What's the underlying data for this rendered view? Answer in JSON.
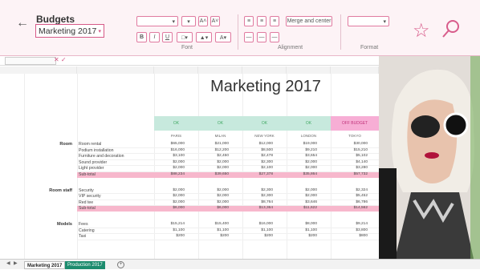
{
  "header": {
    "title": "Budgets",
    "sheet_selected": "Marketing 2017"
  },
  "ribbon": {
    "font_label": "Font",
    "alignment_label": "Alignment",
    "format_label": "Format",
    "merge_label": "Merge and center"
  },
  "sheet": {
    "title": "Marketing 2017",
    "status_row": [
      "OK",
      "OK",
      "OK",
      "OK"
    ],
    "status_alert": "OFF BUDGET",
    "cities": [
      "PARIS",
      "MILAN",
      "NEW YORK",
      "LONDON",
      "TOKYO"
    ],
    "sections": [
      {
        "label": "Room",
        "items": [
          {
            "name": "Room rental",
            "values": [
              "$65,000",
              "$21,000",
              "$12,000",
              "$19,000",
              "$30,000"
            ]
          },
          {
            "name": "Podium installation",
            "values": [
              "$16,000",
              "$12,200",
              "$8,500",
              "$9,210",
              "$15,210"
            ]
          },
          {
            "name": "Furniture and decoration",
            "values": [
              "$3,100",
              "$2,450",
              "$2,478",
              "$3,654",
              "$5,102"
            ]
          },
          {
            "name": "Sound provider",
            "values": [
              "$2,000",
              "$2,000",
              "$2,300",
              "$2,000",
              "$4,140"
            ]
          },
          {
            "name": "Light provider",
            "values": [
              "$2,000",
              "$2,000",
              "$2,100",
              "$2,000",
              "$3,280"
            ]
          }
        ],
        "subtotal": {
          "name": "Sub-total",
          "values": [
            "$88,234",
            "$39,650",
            "$27,378",
            "$35,864",
            "$57,732"
          ]
        }
      },
      {
        "label": "Room staff",
        "items": [
          {
            "name": "Security",
            "values": [
              "$2,000",
              "$2,000",
              "$2,300",
              "$2,000",
              "$2,324"
            ]
          },
          {
            "name": "VIP security",
            "values": [
              "$2,000",
              "$2,000",
              "$2,300",
              "$2,000",
              "$5,452"
            ]
          },
          {
            "name": "Red tee",
            "values": [
              "$2,000",
              "$2,000",
              "$8,764",
              "$3,646",
              "$6,786"
            ]
          }
        ],
        "subtotal": {
          "name": "Sub-total",
          "values": [
            "$6,000",
            "$6,000",
            "$13,364",
            "$11,622",
            "$14,562"
          ]
        }
      },
      {
        "label": "Models",
        "items": [
          {
            "name": "Fees",
            "values": [
              "$15,214",
              "$15,400",
              "$16,000",
              "$8,000",
              "$9,214"
            ]
          },
          {
            "name": "Catering",
            "values": [
              "$1,100",
              "$1,100",
              "$1,100",
              "$1,100",
              "$3,800"
            ]
          },
          {
            "name": "Taxi",
            "values": [
              "$200",
              "$200",
              "$200",
              "$200",
              "$800"
            ]
          }
        ]
      }
    ]
  },
  "tabs": {
    "active": "Marketing 2017",
    "other": "Production 2017"
  },
  "colors": {
    "accent": "#d65a88",
    "ok": "#c7e9dd",
    "alert": "#f7aed5",
    "subtotal": "#f7b7cc"
  }
}
